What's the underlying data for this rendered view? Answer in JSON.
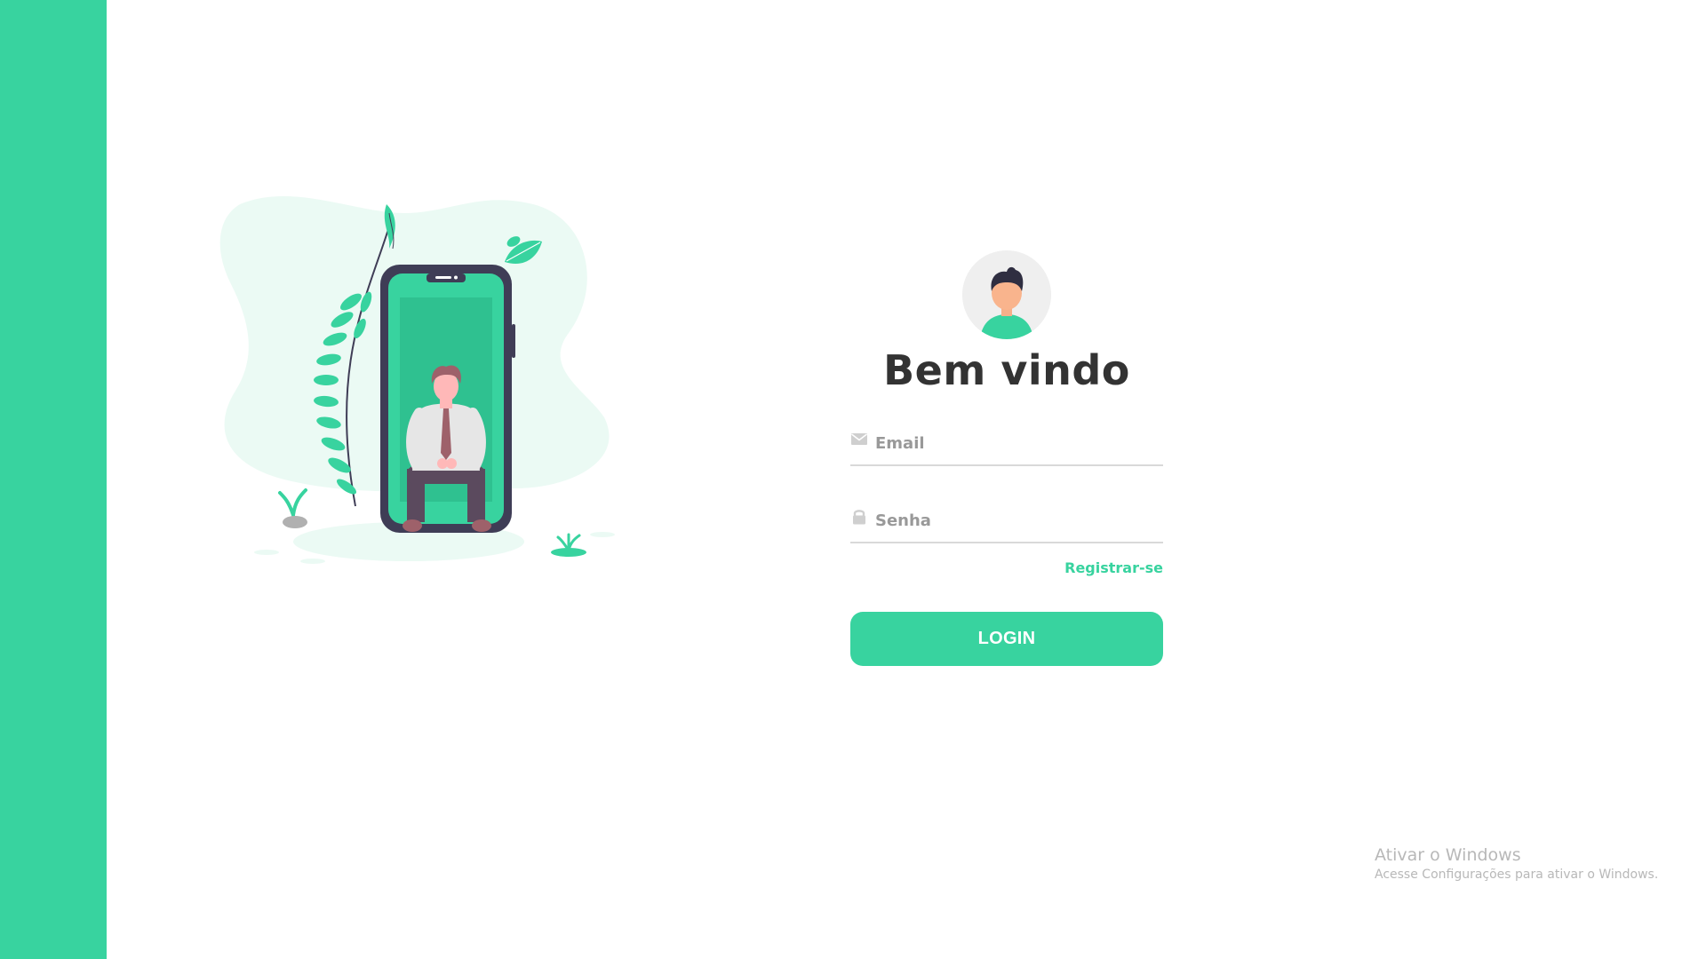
{
  "colors": {
    "accent": "#38d39f",
    "title": "#333333",
    "muted": "#999999",
    "phone_frame": "#3f3d56"
  },
  "illustration": {
    "icon": "man-sitting-on-phone-illustration"
  },
  "login": {
    "avatar_icon": "user-avatar-icon",
    "title": "Bem vindo",
    "email": {
      "icon": "envelope-icon",
      "placeholder": "Email",
      "value": ""
    },
    "password": {
      "icon": "lock-icon",
      "placeholder": "Senha",
      "value": ""
    },
    "register_label": "Registrar-se",
    "submit_label": "LOGIN"
  },
  "watermark": {
    "title": "Ativar o Windows",
    "subtitle": "Acesse Configurações para ativar o Windows."
  }
}
